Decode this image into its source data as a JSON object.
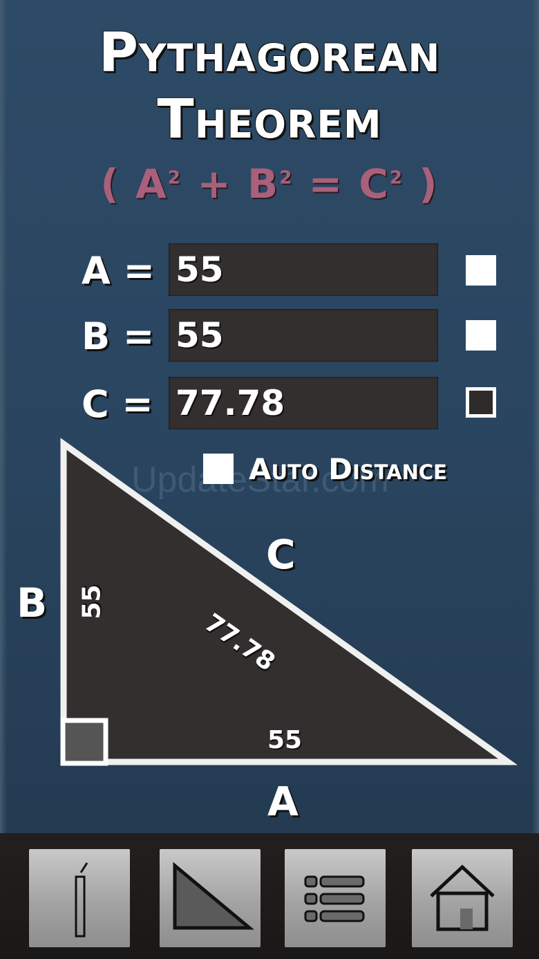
{
  "title": {
    "line1": "Pythagorean",
    "line2": "Theorem"
  },
  "formula": {
    "a": "( A",
    "b": " + B",
    "c": " = C",
    "end": " )",
    "exp": "2"
  },
  "inputs": [
    {
      "label": "A =",
      "value": "55"
    },
    {
      "label": "B =",
      "value": "55"
    },
    {
      "label": "C =",
      "value": "77.78"
    }
  ],
  "auto_distance": {
    "label": "Auto Distance",
    "checked": false
  },
  "watermark": "UpdateStar.com",
  "triangle": {
    "side_labels": {
      "a": "A",
      "b": "B",
      "c": "C"
    },
    "values": {
      "a": "55",
      "b": "55",
      "c": "77.78"
    }
  },
  "toolbar": {
    "buttons": [
      "pencil-icon",
      "triangle-icon",
      "list-icon",
      "home-icon"
    ]
  },
  "colors": {
    "background": "#2a4560",
    "formula": "#a9607a",
    "field": "#332f2f",
    "triangle_fill": "#332f2f"
  }
}
